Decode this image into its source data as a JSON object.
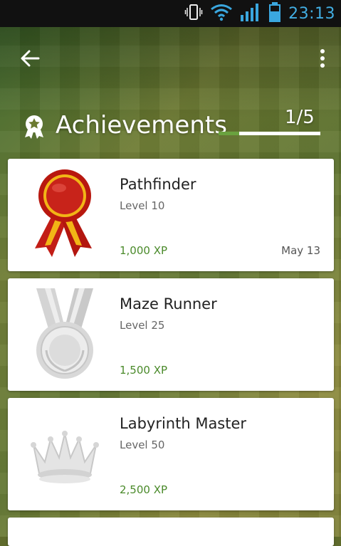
{
  "status_bar": {
    "time": "23:13",
    "icons": [
      "phone-vibrate-icon",
      "wifi-icon",
      "signal-icon",
      "battery-icon"
    ]
  },
  "header": {
    "back_icon": "arrow-left-icon",
    "menu_icon": "more-vertical-icon",
    "title": "Achievements",
    "title_icon": "award-ribbon-icon",
    "progress_text": "1/5",
    "progress_fraction": 0.2
  },
  "achievements": [
    {
      "name": "Pathfinder",
      "level": "Level 10",
      "xp": "1,000 XP",
      "date": "May 13",
      "badge": "red-ribbon-medal-icon"
    },
    {
      "name": "Maze Runner",
      "level": "Level 25",
      "xp": "1,500 XP",
      "date": "",
      "badge": "silver-medal-icon"
    },
    {
      "name": "Labyrinth Master",
      "level": "Level 50",
      "xp": "2,500 XP",
      "date": "",
      "badge": "silver-crown-icon"
    }
  ],
  "colors": {
    "accent_green": "#6aa23f",
    "xp_green": "#4a8a2a",
    "status_blue": "#42aee3"
  }
}
